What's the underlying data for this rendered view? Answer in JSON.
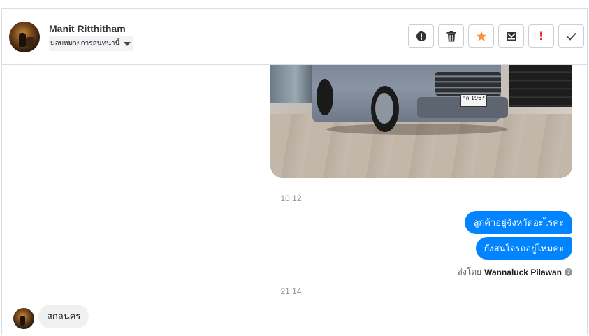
{
  "header": {
    "contact_name": "Manit Ritthitham",
    "assign_label": "มอบหมายการสนทนานี้",
    "tools": [
      {
        "name": "alert-circle-icon"
      },
      {
        "name": "trash-icon"
      },
      {
        "name": "star-icon",
        "color": "#f7923b"
      },
      {
        "name": "archive-icon"
      },
      {
        "name": "exclamation-icon",
        "label": "!",
        "color": "#e02020"
      },
      {
        "name": "check-icon"
      }
    ]
  },
  "conversation": {
    "image_plate_text": "กล 1967",
    "timestamp_1": "10:12",
    "outgoing_messages": [
      "ลูกค้าอยู่จังหวัดอะไรคะ",
      "ยังสนใจรถอยู่ไหมคะ"
    ],
    "sent_by_prefix": "ส่งโดย",
    "sent_by_name": "Wannaluck Pilawan",
    "timestamp_2": "21:14",
    "incoming_message": "สกลนคร"
  },
  "colors": {
    "outgoing_bubble": "#0084ff",
    "incoming_bubble": "#f1f0f0"
  }
}
